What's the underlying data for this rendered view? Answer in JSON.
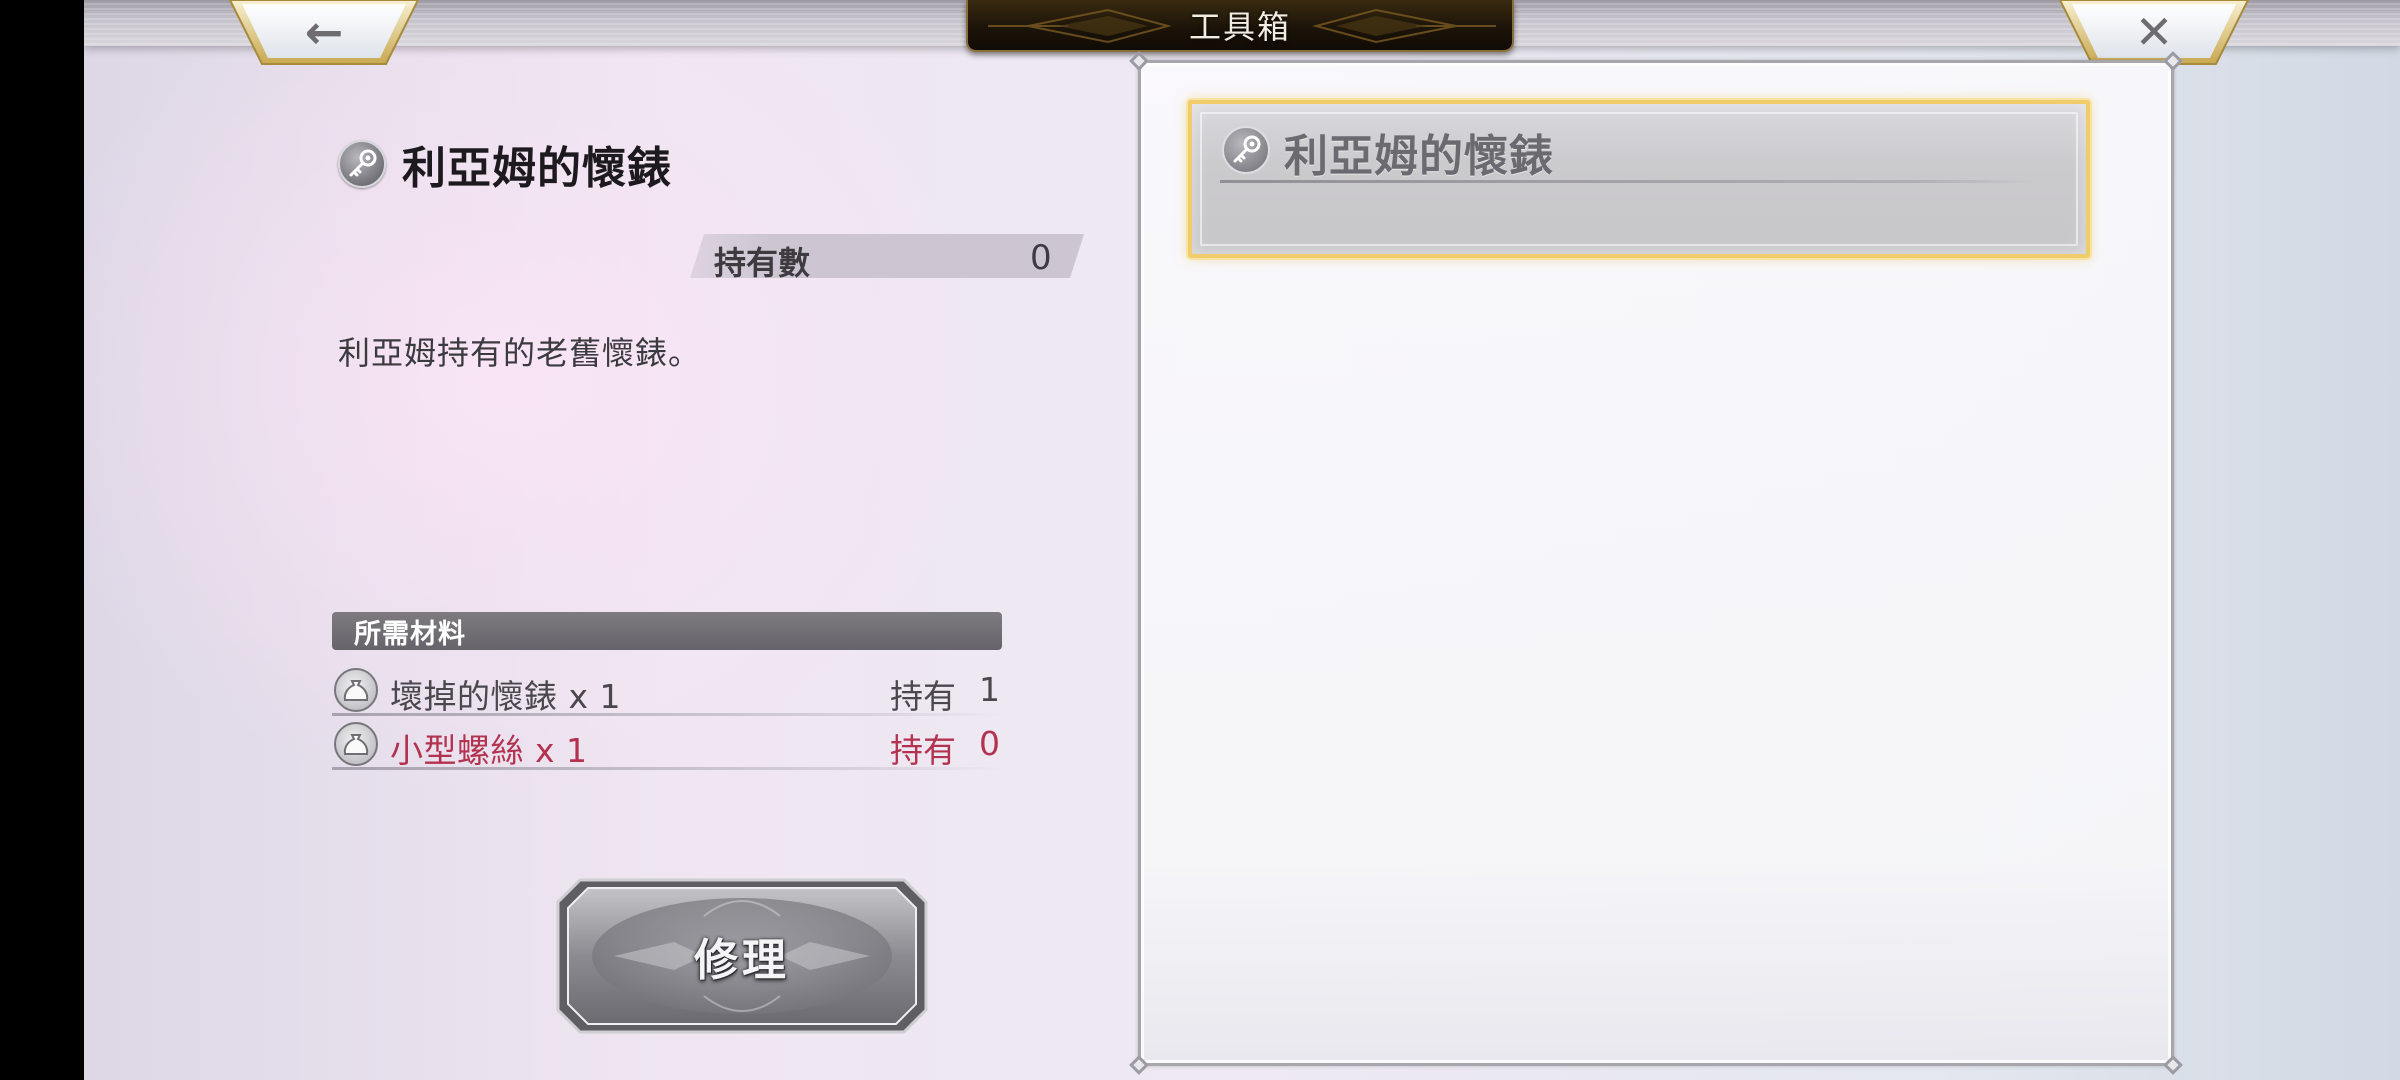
{
  "header": {
    "title": "工具箱",
    "back_icon": "arrow-left-icon",
    "close_icon": "close-icon",
    "back_glyph": "←",
    "close_glyph": "✕"
  },
  "detail": {
    "item_icon": "key-icon",
    "item_name": "利亞姆的懷錶",
    "owned_label": "持有數",
    "owned_value": "0",
    "description": "利亞姆持有的老舊懷錶。",
    "materials_header": "所需材料",
    "materials": [
      {
        "icon": "bag-icon",
        "name": "壞掉的懷錶 x 1",
        "owned_label": "持有",
        "owned_value": "1",
        "status": "sufficient"
      },
      {
        "icon": "bag-icon",
        "name": "小型螺絲 x 1",
        "owned_label": "持有",
        "owned_value": "0",
        "status": "insufficient"
      }
    ],
    "repair_button": "修理"
  },
  "item_list": {
    "entries": [
      {
        "icon": "key-icon",
        "name": "利亞姆的懷錶",
        "selected": true
      }
    ]
  },
  "colors": {
    "accent_gold": "#f0cd6a",
    "insufficient_red": "#b3324f",
    "title_plate": "#1c1409"
  }
}
